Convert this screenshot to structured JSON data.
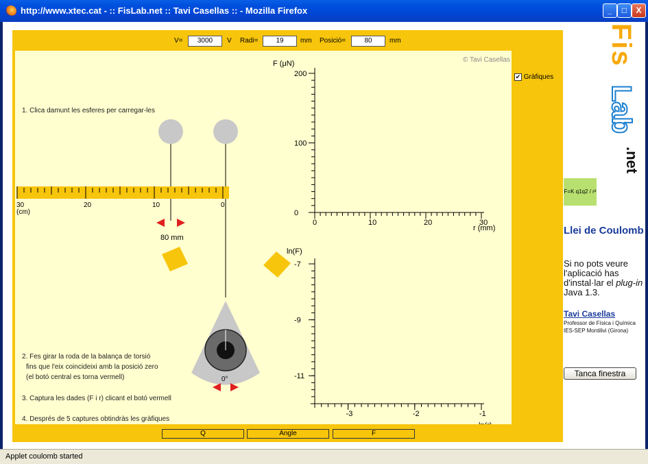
{
  "window": {
    "title": "http://www.xtec.cat - :: FisLab.net :: Tavi Casellas :: - Mozilla Firefox",
    "buttons": [
      "_",
      "□",
      "X"
    ]
  },
  "controls": {
    "v_label": "V=",
    "v_value": "3000",
    "v_unit": "V",
    "radi_label": "Radi=",
    "radi_value": "19",
    "radi_unit": "mm",
    "posicio_label": "Posició=",
    "posicio_value": "80",
    "posicio_unit": "mm"
  },
  "stage": {
    "copyright": "© Tavi Casellas",
    "graphs_checkbox_label": "Gràfiques",
    "graphs_checked": true,
    "instr1": "1. Clica damunt les esferes per carregar-les",
    "instr2a": "2. Fes girar la roda de la balança de torsió",
    "instr2b": "fins que l'eix coincideixi amb la posició zero",
    "instr2c": "(el botó central es torna vermell)",
    "instr3": "3. Captura les dades (F i r) clicant el botó vermell",
    "instr4": "4. Després de 5 captures obtindràs les gràfiques",
    "ruler_labels": [
      "30",
      "20",
      "10",
      "0"
    ],
    "ruler_unit": "(cm)",
    "position_readout": "80 mm",
    "dial_angle": "0°"
  },
  "chart_data": [
    {
      "type": "line",
      "title": "",
      "ylabel": "F (μN)",
      "xlabel": "r (mm)",
      "xlim": [
        0,
        30
      ],
      "ylim": [
        0,
        200
      ],
      "x_ticks": [
        "0",
        "10",
        "20",
        "30"
      ],
      "y_ticks": [
        "0",
        "100",
        "200"
      ],
      "series": []
    },
    {
      "type": "line",
      "title": "",
      "ylabel": "ln(F)",
      "xlabel": "ln(r)",
      "xlim": [
        -3.5,
        -1
      ],
      "ylim": [
        -12,
        -7
      ],
      "x_ticks": [
        "-3",
        "-2",
        "-1"
      ],
      "y_ticks": [
        "-7",
        "-9",
        "-11"
      ],
      "series": []
    }
  ],
  "bottom_buttons": [
    "Q",
    "Angle",
    "F"
  ],
  "sidebar": {
    "logo_fis": "Fis",
    "logo_lab": "Lab",
    "logo_net": ".net",
    "heading": "Llei de Coulomb",
    "desc_1": "Si no pots veure l'aplicació has d'instal·lar el ",
    "desc_plugin": "plug-in",
    "desc_2": " Java 1.3.",
    "author": "Tavi Casellas",
    "affiliation": "Professor de Física i Química IES-SEP Montilivi (Girona)",
    "close_button": "Tanca finestra",
    "formula": "F=K q1q2 / r²"
  },
  "status": {
    "text": "Applet coulomb started"
  },
  "colors": {
    "applet_frame": "#f7c50b",
    "stage_bg": "#ffffd0",
    "titlebar": "#0046d5",
    "link_blue": "#1a3b9a"
  }
}
